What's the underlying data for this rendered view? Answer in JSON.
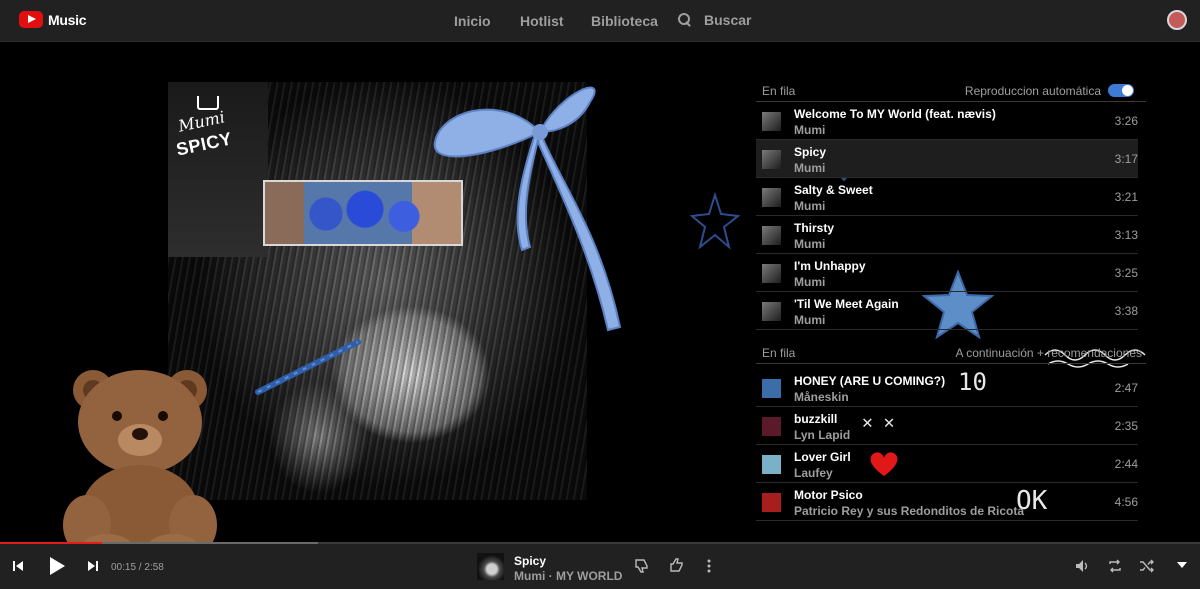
{
  "header": {
    "brand": "Music",
    "nav": [
      "Inicio",
      "Hotlist",
      "Biblioteca"
    ],
    "search_label": "Buscar"
  },
  "album": {
    "sticker_small": "Mumi",
    "sticker_big": "SPICY"
  },
  "queue": {
    "section_label": "En fila",
    "autoplay_label": "Reproduccion automática",
    "autoplay_on": true,
    "tracks": [
      {
        "title": "Welcome To MY World (feat. nævis)",
        "artist": "Mumi",
        "duration": "3:26"
      },
      {
        "title": "Spicy",
        "artist": "Mumi",
        "duration": "3:17"
      },
      {
        "title": "Salty & Sweet",
        "artist": "Mumi",
        "duration": "3:21"
      },
      {
        "title": "Thirsty",
        "artist": "Mumi",
        "duration": "3:13"
      },
      {
        "title": "I'm Unhappy",
        "artist": "Mumi",
        "duration": "3:25"
      },
      {
        "title": "'Til We Meet Again",
        "artist": "Mumi",
        "duration": "3:38"
      }
    ],
    "recs_label": "En fila",
    "recs_right": "A continuación + recomendaciones",
    "recommendations": [
      {
        "title": "HONEY (ARE U COMING?)",
        "artist": "Måneskin",
        "duration": "2:47",
        "thumb_color": "#3b6ea8"
      },
      {
        "title": "buzzkill",
        "artist": "Lyn Lapid",
        "duration": "2:35",
        "thumb_color": "#5a1a2a"
      },
      {
        "title": "Lover Girl",
        "artist": "Laufey",
        "duration": "2:44",
        "thumb_color": "#7ab0c8"
      },
      {
        "title": "Motor Psico",
        "artist": "Patricio Rey y sus Redonditos de Ricota",
        "duration": "4:56",
        "thumb_color": "#a81e1e"
      }
    ]
  },
  "doodles": {
    "ten": "10",
    "xx": "✕ ✕",
    "ok": "OK"
  },
  "player": {
    "time": "00:15 / 2:58",
    "progress": 0.085,
    "buffered": 0.265,
    "now_title": "Spicy",
    "now_sub": "Mumi · MY WORLD"
  },
  "colors": {
    "accent": "#e21b1b",
    "toggle": "#3e7bd6",
    "surface": "#212121"
  }
}
